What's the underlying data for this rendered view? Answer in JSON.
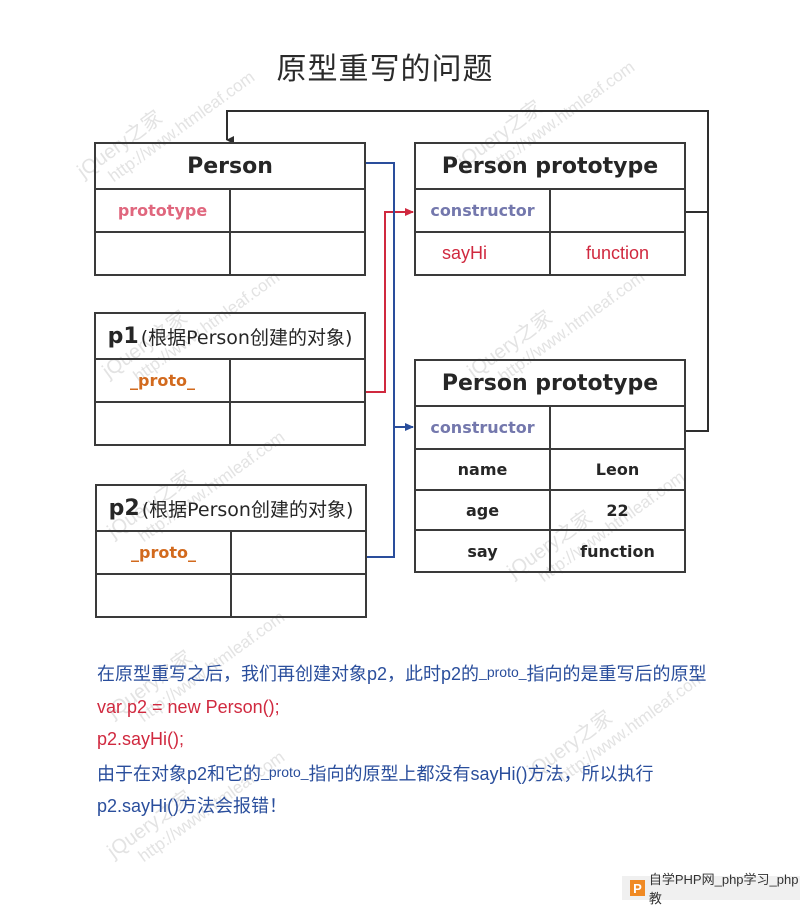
{
  "title": "原型重写的问题",
  "watermark": {
    "line1": "jQuery之家",
    "line2": "http://www.htmleaf.com"
  },
  "colors": {
    "border": "#3a3a3a",
    "red_link": "#d0293f",
    "blue_link": "#2a4e9c",
    "black_link": "#2e2e2e",
    "prototype_key": "#e0677e",
    "proto_key": "#d26a1e",
    "constructor_key": "#7478ad"
  },
  "boxes": {
    "person": {
      "header": "Person",
      "rows": [
        {
          "key": "prototype",
          "value": ""
        },
        {
          "key": "",
          "value": ""
        }
      ]
    },
    "old_prototype": {
      "header": "Person prototype",
      "rows": [
        {
          "key": "constructor",
          "value": ""
        },
        {
          "key": "sayHi",
          "value": "function"
        }
      ]
    },
    "p1": {
      "header_main": "p1",
      "header_sub": "(根据Person创建的对象)",
      "rows": [
        {
          "key": "_proto_",
          "value": ""
        },
        {
          "key": "",
          "value": ""
        }
      ]
    },
    "p2": {
      "header_main": "p2",
      "header_sub": "(根据Person创建的对象)",
      "rows": [
        {
          "key": "_proto_",
          "value": ""
        },
        {
          "key": "",
          "value": ""
        }
      ]
    },
    "new_prototype": {
      "header": "Person prototype",
      "rows": [
        {
          "key": "constructor",
          "value": ""
        },
        {
          "key": "name",
          "value": "Leon"
        },
        {
          "key": "age",
          "value": "22"
        },
        {
          "key": "say",
          "value": "function"
        }
      ]
    }
  },
  "connectors": [
    {
      "from": "p1._proto_",
      "to": "old_prototype",
      "color": "red"
    },
    {
      "from": "person.prototype",
      "to": "new_prototype",
      "color": "blue"
    },
    {
      "from": "p2._proto_",
      "to": "new_prototype",
      "color": "blue"
    },
    {
      "from": "old_prototype.constructor",
      "to": "person",
      "color": "black"
    },
    {
      "from": "new_prototype.constructor",
      "to": "person",
      "color": "black"
    }
  ],
  "explanation": {
    "line1_a": "在原型重写之后，我们再创建对象p2，此时p2的",
    "line1_proto": "_proto_",
    "line1_b": "指向的是重写后的原型",
    "line2": "var p2 = new Person();",
    "line3": "p2.sayHi();",
    "line4_a": "由于在对象p2和它的",
    "line4_proto": "_proto_",
    "line4_b": "指向的原型上都没有sayHi()方法，所以执行",
    "line5": "p2.sayHi()方法会报错！"
  },
  "footer": {
    "logo": "P",
    "text": "自学PHP网_php学习_php教"
  }
}
